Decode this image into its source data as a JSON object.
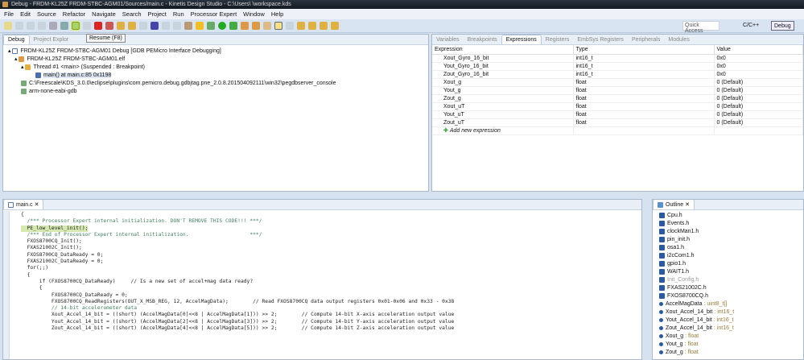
{
  "window": {
    "title": "Debug - FRDM-KL25Z FRDM-STBC-AGM01/Sources/main.c - Kinetis Design Studio - C:\\Users\\            \\workspace.kds"
  },
  "menu": [
    "File",
    "Edit",
    "Source",
    "Refactor",
    "Navigate",
    "Search",
    "Project",
    "Run",
    "Processor Expert",
    "Window",
    "Help"
  ],
  "toolbar": {
    "tooltip": "Resume (F8)",
    "quick_access": "Quick Access",
    "perspectives": [
      "C/C++",
      "Debug"
    ]
  },
  "debug_view": {
    "tabs": [
      "Debug",
      "Project Explor"
    ],
    "tree": [
      "FRDM-KL25Z FRDM-STBC-AGM01 Debug [GDB PEMicro Interface Debugging]",
      "FRDM-KL25Z FRDM-STBC-AGM01.elf",
      "Thread #1 <main> (Suspended : Breakpoint)",
      "main() at main.c:85 0x1198",
      "C:\\Freescale\\KDS_3.0.0\\eclipse\\plugins\\com.pemicro.debug.gdbjtag.pne_2.0.8.201504092111\\win32\\pegdbserver_console",
      "arm-none-eabi-gdb"
    ]
  },
  "expressions_view": {
    "tabs": [
      "Variables",
      "Breakpoints",
      "Expressions",
      "Registers",
      "EmbSys Registers",
      "Peripherals",
      "Modules"
    ],
    "columns": [
      "Expression",
      "Type",
      "Value"
    ],
    "rows": [
      [
        "Xout_Gyro_16_bit",
        "int16_t",
        "0x0"
      ],
      [
        "Yout_Gyro_16_bit",
        "int16_t",
        "0x0"
      ],
      [
        "Zout_Gyro_16_bit",
        "int16_t",
        "0x0"
      ],
      [
        "Xout_g",
        "float",
        "0 (Default)"
      ],
      [
        "Yout_g",
        "float",
        "0 (Default)"
      ],
      [
        "Zout_g",
        "float",
        "0 (Default)"
      ],
      [
        "Xout_uT",
        "float",
        "0 (Default)"
      ],
      [
        "Yout_uT",
        "float",
        "0 (Default)"
      ],
      [
        "Zout_uT",
        "float",
        "0 (Default)"
      ]
    ],
    "add_label": "Add new expression"
  },
  "editor": {
    "tab": "main.c",
    "lines": [
      "{",
      "  /*** Processor Expert internal initialization. DON'T REMOVE THIS CODE!!! ***/",
      "  PE_low_level_init();",
      "  /*** End of Processor Expert internal initialization.                    ***/",
      "",
      "  FXOS8700CQ_Init();",
      "  FXAS21002C_Init();",
      "  FXOS8700CQ_DataReady = 0;",
      "  FXAS21002C_DataReady = 0;",
      "",
      "  for(;;)",
      "  {",
      "      if (FXOS8700CQ_DataReady)     // Is a new set of accel+mag data ready?",
      "      {",
      "          FXOS8700CQ_DataReady = 0;",
      "",
      "          FXOS8700CQ_ReadRegisters(OUT_X_MSB_REG, 12, AccelMagData);        // Read FXOS8700CQ data output registers 0x01-0x06 and 0x33 - 0x38",
      "",
      "          // 14-bit accelerometer data",
      "          Xout_Accel_14_bit = ((short) (AccelMagData[0]<<8 | AccelMagData[1])) >> 2;        // Compute 14-bit X-axis acceleration output value",
      "          Yout_Accel_14_bit = ((short) (AccelMagData[2]<<8 | AccelMagData[3])) >> 2;        // Compute 14-bit Y-axis acceleration output value",
      "          Zout_Accel_14_bit = ((short) (AccelMagData[4]<<8 | AccelMagData[5])) >> 2;        // Compute 14-bit Z-axis acceleration output value"
    ]
  },
  "outline": {
    "title": "Outline",
    "items": [
      [
        "Cpu.h",
        ""
      ],
      [
        "Events.h",
        ""
      ],
      [
        "clockMan1.h",
        ""
      ],
      [
        "pin_init.h",
        ""
      ],
      [
        "osa1.h",
        ""
      ],
      [
        "i2cCom1.h",
        ""
      ],
      [
        "gpio1.h",
        ""
      ],
      [
        "WAIT1.h",
        ""
      ],
      [
        "Init_Config.h",
        ""
      ],
      [
        "FXAS21002C.h",
        ""
      ],
      [
        "FXOS8700CQ.h",
        ""
      ],
      [
        "AccelMagData",
        " : uint8_t[]"
      ],
      [
        "Xout_Accel_14_bit",
        " : int16_t"
      ],
      [
        "Yout_Accel_14_bit",
        " : int16_t"
      ],
      [
        "Zout_Accel_14_bit",
        " : int16_t"
      ],
      [
        "Xout_g",
        " : float"
      ],
      [
        "Yout_g",
        " : float"
      ],
      [
        "Zout_g",
        " : float"
      ]
    ]
  }
}
